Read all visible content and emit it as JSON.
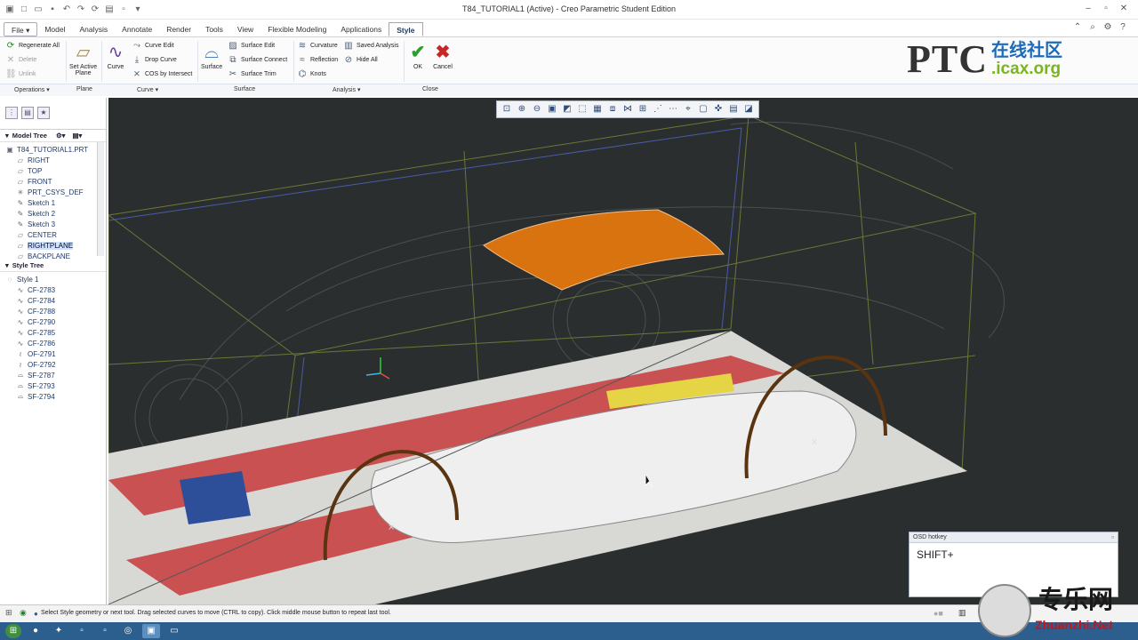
{
  "window": {
    "title": "T84_TUTORIAL1 (Active) - Creo Parametric Student Edition"
  },
  "tabs": [
    {
      "label": "File",
      "type": "file"
    },
    {
      "label": "Model"
    },
    {
      "label": "Analysis"
    },
    {
      "label": "Annotate"
    },
    {
      "label": "Render"
    },
    {
      "label": "Tools"
    },
    {
      "label": "View"
    },
    {
      "label": "Flexible Modeling"
    },
    {
      "label": "Applications"
    },
    {
      "label": "Style",
      "active": true
    }
  ],
  "ribbon": {
    "operations": {
      "regenerate": "Regenerate All",
      "delete": "Delete",
      "unlink": "Unlink",
      "group": "Operations"
    },
    "plane": {
      "set_active": "Set Active",
      "plane": "Plane",
      "group": "Plane"
    },
    "curve": {
      "curve": "Curve",
      "curve_edit": "Curve Edit",
      "drop_curve": "Drop Curve",
      "cos": "COS by Intersect",
      "group": "Curve"
    },
    "surface": {
      "surface": "Surface",
      "surface_edit": "Surface Edit",
      "surface_connect": "Surface Connect",
      "surface_trim": "Surface Trim",
      "group": "Surface"
    },
    "analysis": {
      "curvature": "Curvature",
      "reflection": "Reflection",
      "knots": "Knots",
      "saved": "Saved Analysis",
      "hide_all": "Hide All",
      "group": "Analysis"
    },
    "close": {
      "ok": "OK",
      "cancel": "Cancel",
      "group": "Close"
    }
  },
  "logo": {
    "ptc": "PTC",
    "cn": "在线社区",
    "url": ".icax.org"
  },
  "model_tree": {
    "title": "Model Tree",
    "items": [
      {
        "label": "T84_TUTORIAL1.PRT",
        "icon": "part-icon"
      },
      {
        "label": "RIGHT",
        "icon": "plane-icon"
      },
      {
        "label": "TOP",
        "icon": "plane-icon"
      },
      {
        "label": "FRONT",
        "icon": "plane-icon"
      },
      {
        "label": "PRT_CSYS_DEF",
        "icon": "csys-icon"
      },
      {
        "label": "Sketch 1",
        "icon": "sketch-icon"
      },
      {
        "label": "Sketch 2",
        "icon": "sketch-icon"
      },
      {
        "label": "Sketch 3",
        "icon": "sketch-icon"
      },
      {
        "label": "CENTER",
        "icon": "plane-icon"
      },
      {
        "label": "RIGHTPLANE",
        "icon": "plane-icon",
        "selected": true
      },
      {
        "label": "BACKPLANE",
        "icon": "plane-icon"
      }
    ]
  },
  "style_tree": {
    "title": "Style Tree",
    "items": [
      {
        "label": "Style 1",
        "icon": "style-icon"
      },
      {
        "label": "CF-2783",
        "icon": "curve-icon"
      },
      {
        "label": "CF-2784",
        "icon": "curve-icon"
      },
      {
        "label": "CF-2788",
        "icon": "curve-icon"
      },
      {
        "label": "CF-2790",
        "icon": "curve-icon"
      },
      {
        "label": "CF-2785",
        "icon": "curve-icon"
      },
      {
        "label": "CF-2786",
        "icon": "curve-icon"
      },
      {
        "label": "OF-2791",
        "icon": "offset-curve-icon"
      },
      {
        "label": "OF-2792",
        "icon": "offset-curve-icon"
      },
      {
        "label": "SF-2787",
        "icon": "surface-icon"
      },
      {
        "label": "SF-2793",
        "icon": "surface-icon"
      },
      {
        "label": "SF-2794",
        "icon": "surface-icon"
      }
    ]
  },
  "osd": {
    "title": "OSD hotkey",
    "text": "SHIFT+"
  },
  "status": {
    "message": "Select Style geometry or next tool. Drag selected curves to move (CTRL to copy). Click middle mouse button to repeat last tool."
  },
  "watermark": {
    "cn": "专乐网",
    "url": "Zhuanzhi.Net"
  },
  "colors": {
    "surface": "#d9730f",
    "background": "#2b2e2e",
    "curve": "#5a3410",
    "ribbon": "#fbfbfc",
    "accent": "#1f3a5c"
  }
}
